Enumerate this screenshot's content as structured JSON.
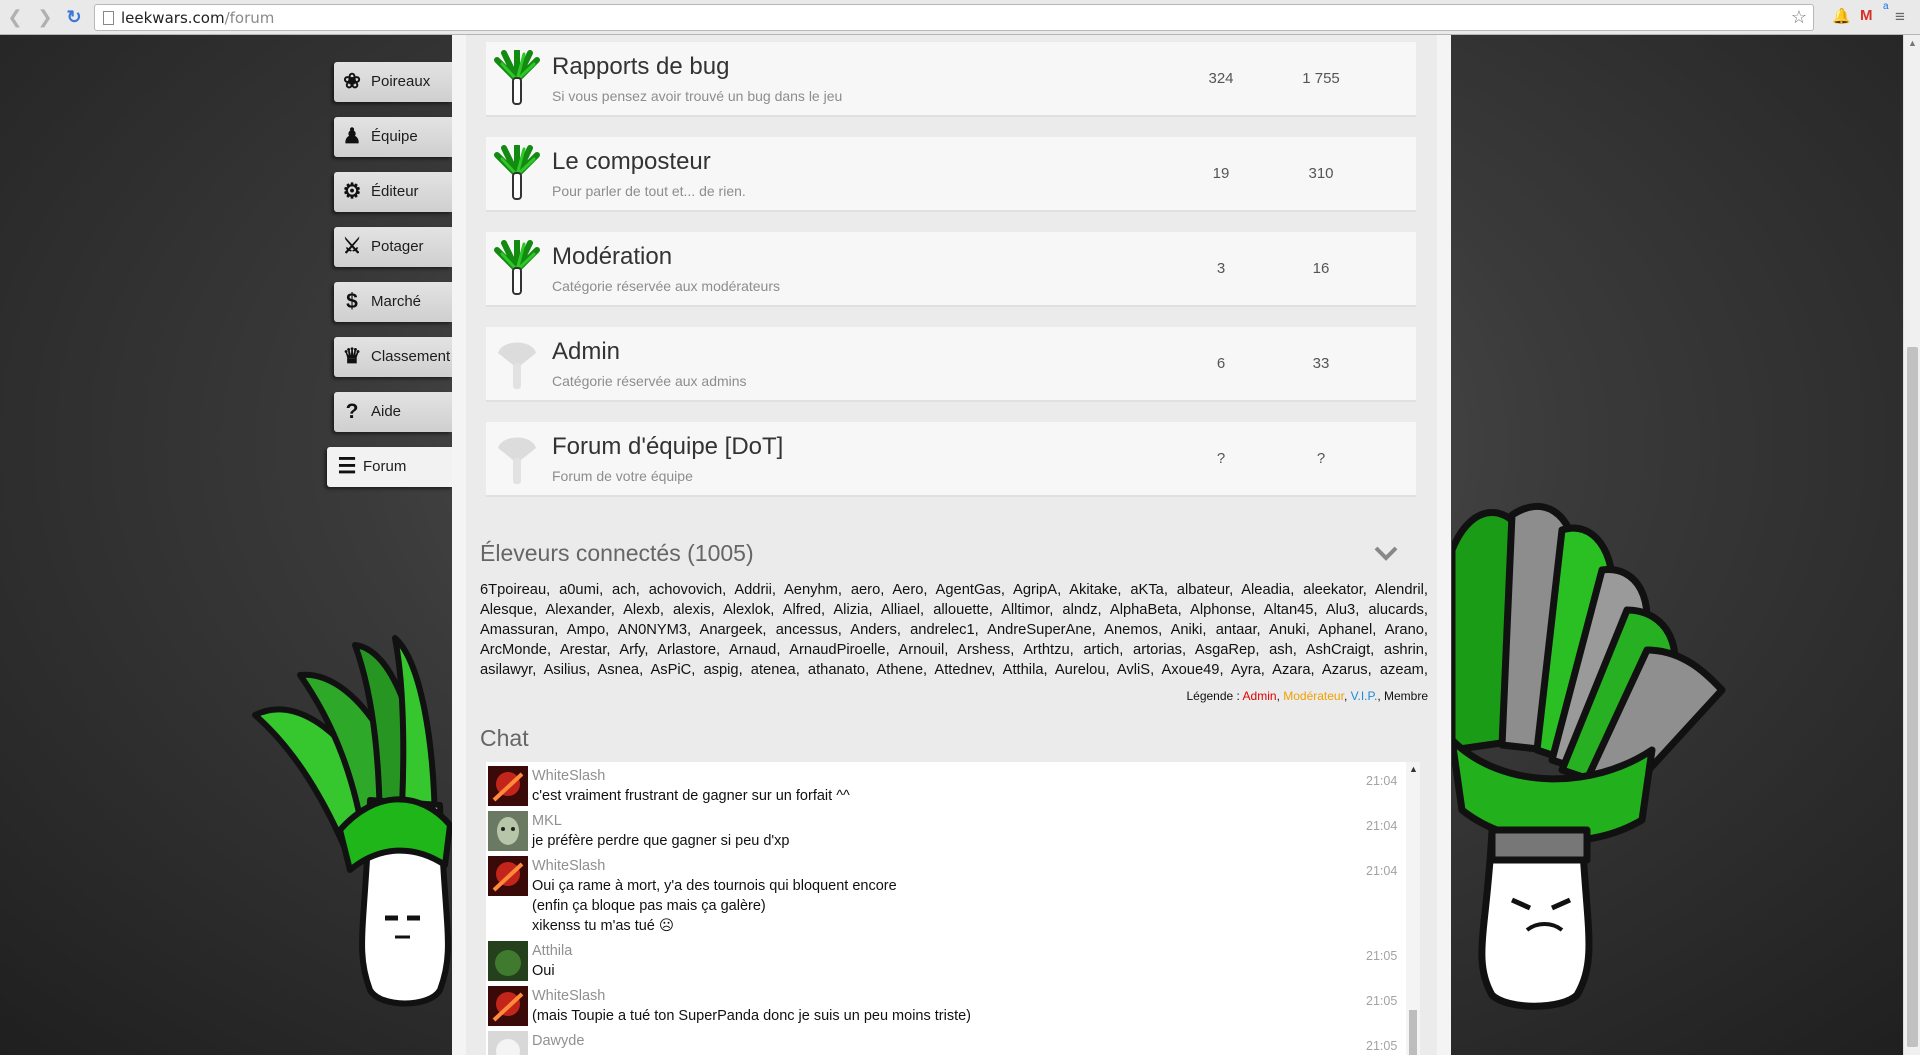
{
  "browser": {
    "url_host": "leekwars.com",
    "url_path": "/forum"
  },
  "menu": [
    {
      "label": "Poireaux",
      "icon": "leek-icon"
    },
    {
      "label": "Équipe",
      "icon": "team-icon"
    },
    {
      "label": "Éditeur",
      "icon": "gear-icon"
    },
    {
      "label": "Potager",
      "icon": "swords-icon"
    },
    {
      "label": "Marché",
      "icon": "dollar-icon"
    },
    {
      "label": "Classement",
      "icon": "trophy-icon"
    },
    {
      "label": "Aide",
      "icon": "question-icon"
    },
    {
      "label": "Forum",
      "icon": "list-icon"
    }
  ],
  "forums": [
    {
      "title": "Rapports de bug",
      "desc": "Si vous pensez avoir trouvé un bug dans le jeu",
      "topics": "324",
      "messages": "1 755",
      "icon": "green"
    },
    {
      "title": "Le composteur",
      "desc": "Pour parler de tout et... de rien.",
      "topics": "19",
      "messages": "310",
      "icon": "green"
    },
    {
      "title": "Modération",
      "desc": "Catégorie réservée aux modérateurs",
      "topics": "3",
      "messages": "16",
      "icon": "green"
    },
    {
      "title": "Admin",
      "desc": "Catégorie réservée aux admins",
      "topics": "6",
      "messages": "33",
      "icon": "grey"
    },
    {
      "title": "Forum d'équipe [DoT]",
      "desc": "Forum de votre équipe",
      "topics": "?",
      "messages": "?",
      "icon": "grey"
    }
  ],
  "online": {
    "title": "Éleveurs connectés (1005)",
    "lines": [
      "6Tpoireau, a0umi, ach, achovovich, Addrii, Aenyhm, aero, Aero, AgentGas, AgripA, Akitake, aKTa, albateur, Aleadia, aleekator, Alendril,",
      "Alesque, Alexander, Alexb, alexis, Alexlok, Alfred, Alizia, Alliael, allouette, Alltimor, alndz, AlphaBeta, Alphonse, Altan45, Alu3, alucards,",
      "Amassuran, Ampo, AN0NYM3, Anargeek, ancessus, Anders, andrelec1, AndreSuperAne, Anemos, Aniki, antaar, Anuki, Aphanel, Arano,",
      "ArcMonde, Arestar, Arfy, Arlastore, Arnaud, ArnaudPiroelle, Arnouil, Arshess, Arthtzu, artich, artorias, AsgaRep, ash, AshCraigt, ashrin,",
      "asilawyr, Asilius, Asnea, AsPiC, aspig, atenea, athanato, Athene, Attednev, Atthila, Aurelou, AvliS, Axoue49, Ayra, Azara, Azarus, azeam,"
    ],
    "legend": {
      "prefix": "Légende : ",
      "admin": "Admin",
      "moderator": "Modérateur",
      "vip": "V.I.P.",
      "member": "Membre",
      "sep": ", "
    },
    "colors": {
      "admin": "#e00000",
      "moderator": "#f0a000",
      "vip": "#1a8cd8"
    }
  },
  "chat": {
    "title": "Chat",
    "messages": [
      {
        "author": "WhiteSlash",
        "time": "21:04",
        "lines": [
          "c'est vraiment frustrant de gagner sur un forfait ^^"
        ],
        "avatar": "red"
      },
      {
        "author": "MKL",
        "time": "21:04",
        "lines": [
          "je préfère perdre que gagner si peu d'xp"
        ],
        "avatar": "face"
      },
      {
        "author": "WhiteSlash",
        "time": "21:04",
        "lines": [
          "Oui ça rame à mort, y'a des tournois qui bloquent encore",
          "(enfin ça bloque pas mais ça galère)",
          "xikenss tu m'as tué ☹"
        ],
        "avatar": "red"
      },
      {
        "author": "Atthila",
        "time": "21:05",
        "lines": [
          "Oui"
        ],
        "avatar": "green"
      },
      {
        "author": "WhiteSlash",
        "time": "21:05",
        "lines": [
          "(mais Toupie a tué ton SuperPanda donc je suis un peu moins triste)"
        ],
        "avatar": "red"
      },
      {
        "author": "Dawyde",
        "time": "21:05",
        "lines": [],
        "avatar": "white"
      }
    ]
  }
}
